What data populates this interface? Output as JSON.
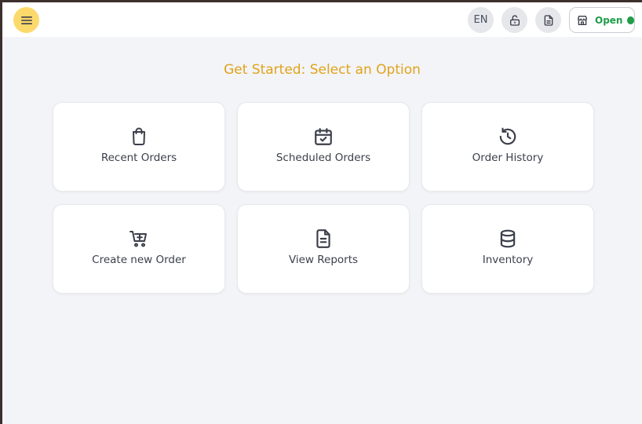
{
  "topbar": {
    "menu_icon": "hamburger-icon",
    "language": "EN",
    "lock_icon": "unlock-icon",
    "doc_icon": "document-icon",
    "status": {
      "label": "Open",
      "icon": "store-icon",
      "color": "#1f9d48"
    }
  },
  "main": {
    "heading": "Get Started: Select an Option",
    "heading_color": "#e0a31a",
    "options": [
      {
        "label": "Recent Orders",
        "icon": "shopping-bag-icon"
      },
      {
        "label": "Scheduled Orders",
        "icon": "calendar-check-icon"
      },
      {
        "label": "Order History",
        "icon": "history-icon"
      },
      {
        "label": "Create new Order",
        "icon": "cart-plus-icon"
      },
      {
        "label": "View Reports",
        "icon": "report-icon"
      },
      {
        "label": "Inventory",
        "icon": "database-icon"
      }
    ]
  }
}
